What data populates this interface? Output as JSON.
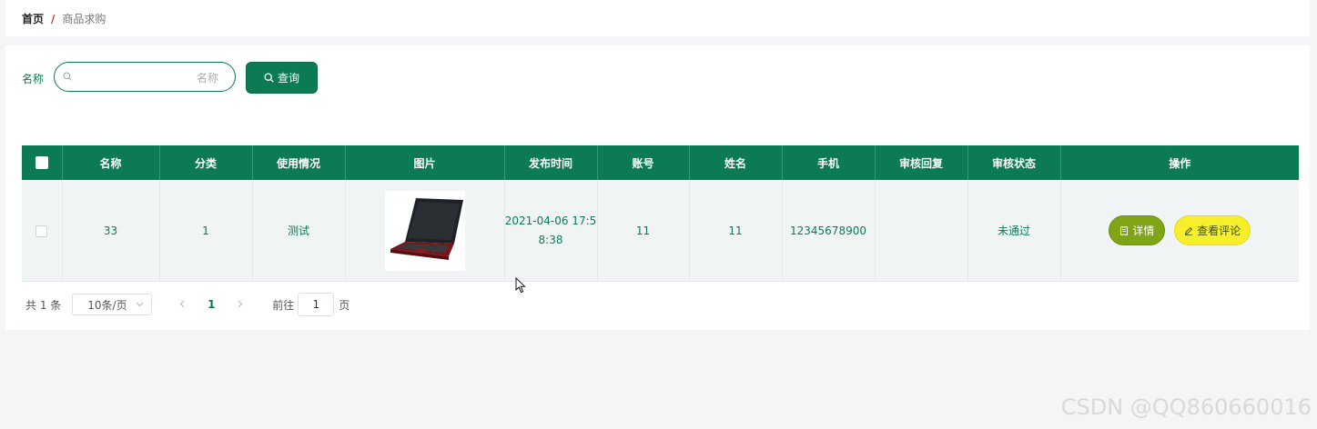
{
  "breadcrumb": {
    "home": "首页",
    "separator": "/",
    "current": "商品求购"
  },
  "search": {
    "label": "名称",
    "placeholder": "名称",
    "value": "",
    "button_label": "查询"
  },
  "table": {
    "headers": [
      "名称",
      "分类",
      "使用情况",
      "图片",
      "发布时间",
      "账号",
      "姓名",
      "手机",
      "审核回复",
      "审核状态",
      "操作"
    ],
    "rows": [
      {
        "name": "33",
        "category": "1",
        "usage": "测试",
        "image": "laptop-image",
        "publish_time": "2021-04-06 17:58:38",
        "account": "11",
        "real_name": "11",
        "phone": "12345678900",
        "review_reply": "",
        "review_status": "未通过",
        "actions": {
          "detail": "详情",
          "view_comments": "查看评论"
        }
      }
    ]
  },
  "pagination": {
    "total_text": "共 1 条",
    "page_size": "10条/页",
    "current_page": "1",
    "goto_label": "前往",
    "goto_value": "1",
    "page_unit": "页"
  },
  "watermark": "CSDN @QQ860660016",
  "colors": {
    "primary": "#0b7a55",
    "detail_button": "#7fa516",
    "review_button": "#f7ef2c"
  },
  "icons": [
    "search-icon",
    "document-icon",
    "edit-icon",
    "chevron-down-icon",
    "chevron-left-icon",
    "chevron-right-icon",
    "cursor-icon"
  ]
}
